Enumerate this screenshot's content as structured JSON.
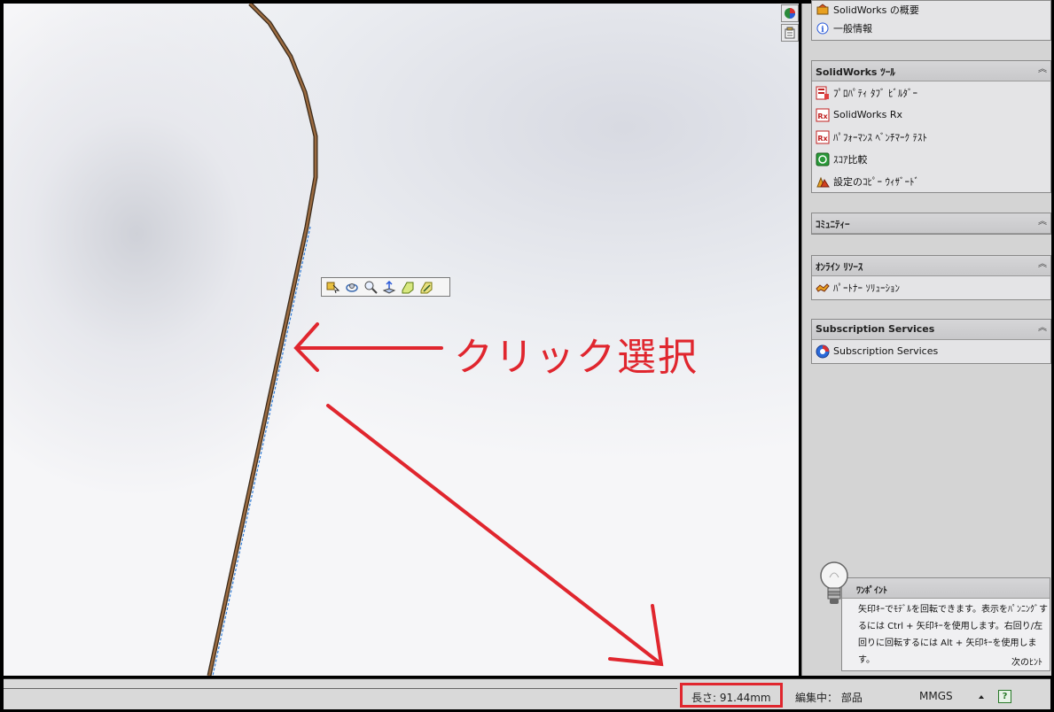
{
  "viewport": {
    "callout_text": "クリック選択"
  },
  "view_toolbar": {
    "icons": [
      "appearance-icon",
      "view-palette-icon"
    ]
  },
  "context_toolbar": {
    "icons": [
      "select-other-icon",
      "rotate-view-icon",
      "zoom-to-selection-icon",
      "normal-to-icon",
      "sketch-icon",
      "edit-sketch-icon"
    ]
  },
  "task_pane": {
    "top_panel": {
      "items": [
        {
          "label": "SolidWorks の概要",
          "icon": "overview-icon"
        },
        {
          "label": "一般情報",
          "icon": "info-icon"
        }
      ]
    },
    "tools_panel": {
      "title": "SolidWorks ﾂｰﾙ",
      "items": [
        {
          "label": "ﾌﾟﾛﾊﾟﾃｨ ﾀﾌﾞ ﾋﾞﾙﾀﾞｰ",
          "icon": "property-tab-builder-icon"
        },
        {
          "label": "SolidWorks Rx",
          "icon": "solidworks-rx-icon"
        },
        {
          "label": "ﾊﾟﾌｫｰﾏﾝｽ ﾍﾞﾝﾁﾏｰｸ ﾃｽﾄ",
          "icon": "benchmark-icon"
        },
        {
          "label": "ｽｺｱ比較",
          "icon": "score-compare-icon"
        },
        {
          "label": "設定のｺﾋﾟｰ ｳｨｻﾞｰﾄﾞ",
          "icon": "copy-settings-wizard-icon"
        }
      ]
    },
    "community_panel": {
      "title": "ｺﾐｭﾆﾃｨｰ"
    },
    "online_panel": {
      "title": "ｵﾝﾗｲﾝ ﾘｿｰｽ",
      "items": [
        {
          "label": "ﾊﾟｰﾄﾅｰ ｿﾘｭｰｼｮﾝ",
          "icon": "partner-solutions-icon"
        }
      ]
    },
    "subscription_panel": {
      "title": "Subscription Services",
      "items": [
        {
          "label": "Subscription Services",
          "icon": "subscription-icon"
        }
      ]
    },
    "tip": {
      "title": "ﾜﾝﾎﾟｲﾝﾄ",
      "body": "矢印ｷｰでﾓﾃﾞﾙを回転できます。表示をﾊﾟﾝﾆﾝｸﾞするには Ctrl + 矢印ｷｰを使用します。右回り/左回りに回転するには Alt + 矢印ｷｰを使用します。",
      "next_label": "次のﾋﾝﾄ"
    }
  },
  "statusbar": {
    "length_label": "長さ: 91.44mm",
    "editing_label": "編集中： 部品",
    "units_label": "MMGS",
    "help_label": "?"
  },
  "colors": {
    "annotation_red": "#e0262e",
    "edge_brown": "#8a5a33",
    "selection_blue": "#2e7bd6"
  }
}
